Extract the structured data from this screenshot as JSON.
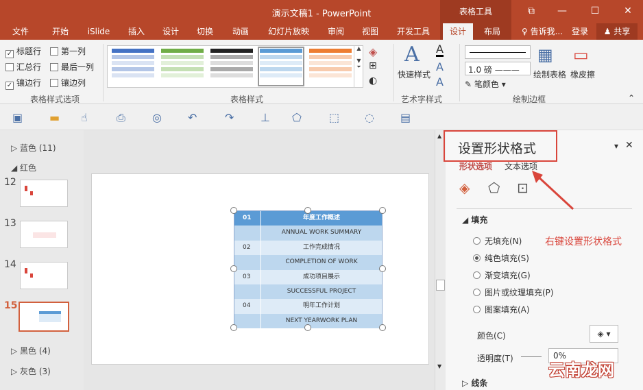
{
  "window": {
    "title": "演示文稿1 - PowerPoint",
    "context_tab": "表格工具",
    "buttons": [
      "⧉",
      "—",
      "☐",
      "✕"
    ]
  },
  "tabs": [
    {
      "label": "文件"
    },
    {
      "label": "开始"
    },
    {
      "label": "iSlide"
    },
    {
      "label": "插入"
    },
    {
      "label": "设计"
    },
    {
      "label": "切换"
    },
    {
      "label": "动画"
    },
    {
      "label": "幻灯片放映"
    },
    {
      "label": "审阅"
    },
    {
      "label": "视图"
    },
    {
      "label": "开发工具"
    },
    {
      "label": "设计"
    },
    {
      "label": "布局"
    }
  ],
  "tell_me": "告诉我...",
  "login": "登录",
  "share": "共享",
  "ribbon": {
    "style_options": {
      "checkboxes": [
        {
          "label": "标题行",
          "checked": true
        },
        {
          "label": "第一列",
          "checked": false
        },
        {
          "label": "汇总行",
          "checked": false
        },
        {
          "label": "最后一列",
          "checked": false
        },
        {
          "label": "镶边行",
          "checked": true
        },
        {
          "label": "镶边列",
          "checked": false
        }
      ],
      "group_label": "表格样式选项"
    },
    "table_styles": {
      "group_label": "表格样式",
      "colors": [
        "#4472c4",
        "#70ad47",
        "#595959",
        "#5b9bd5",
        "#ed7d31"
      ]
    },
    "wordart": {
      "button": "快速样式",
      "group_label": "艺术字样式"
    },
    "borders": {
      "pen_weight": "1.0 磅",
      "pen_color": "笔颜色",
      "draw_table": "绘制表格",
      "eraser": "橡皮擦",
      "group_label": "绘制边框"
    }
  },
  "slides_panel": {
    "sections": [
      {
        "label": "蓝色 (11)"
      },
      {
        "label": "红色"
      },
      {
        "label": "黑色 (4)"
      },
      {
        "label": "灰色 (3)"
      }
    ],
    "slides": [
      {
        "num": "12"
      },
      {
        "num": "13"
      },
      {
        "num": "14"
      },
      {
        "num": "15"
      }
    ]
  },
  "table": {
    "rows": [
      {
        "c1": "01",
        "c2": "年度工作概述"
      },
      {
        "c1": "",
        "c2": "ANNUAL WORK SUMMARY"
      },
      {
        "c1": "02",
        "c2": "工作完成情况"
      },
      {
        "c1": "",
        "c2": "COMPLETION OF WORK"
      },
      {
        "c1": "03",
        "c2": "成功项目展示"
      },
      {
        "c1": "",
        "c2": "SUCCESSFUL PROJECT"
      },
      {
        "c1": "04",
        "c2": "明年工作计划"
      },
      {
        "c1": "",
        "c2": "NEXT YEARWORK PLAN"
      }
    ]
  },
  "pane": {
    "title": "设置形状格式",
    "tabs": [
      "形状选项",
      "文本选项"
    ],
    "fill_section": "填充",
    "fill_options": [
      {
        "label": "无填充(N)",
        "on": false
      },
      {
        "label": "纯色填充(S)",
        "on": true
      },
      {
        "label": "渐变填充(G)",
        "on": false
      },
      {
        "label": "图片或纹理填充(P)",
        "on": false
      },
      {
        "label": "图案填充(A)",
        "on": false
      }
    ],
    "color_label": "颜色(C)",
    "transparency_label": "透明度(T)",
    "transparency_value": "0%",
    "line_section": "线条",
    "annotation": "右键设置形状格式"
  },
  "watermark": "云南龙网"
}
